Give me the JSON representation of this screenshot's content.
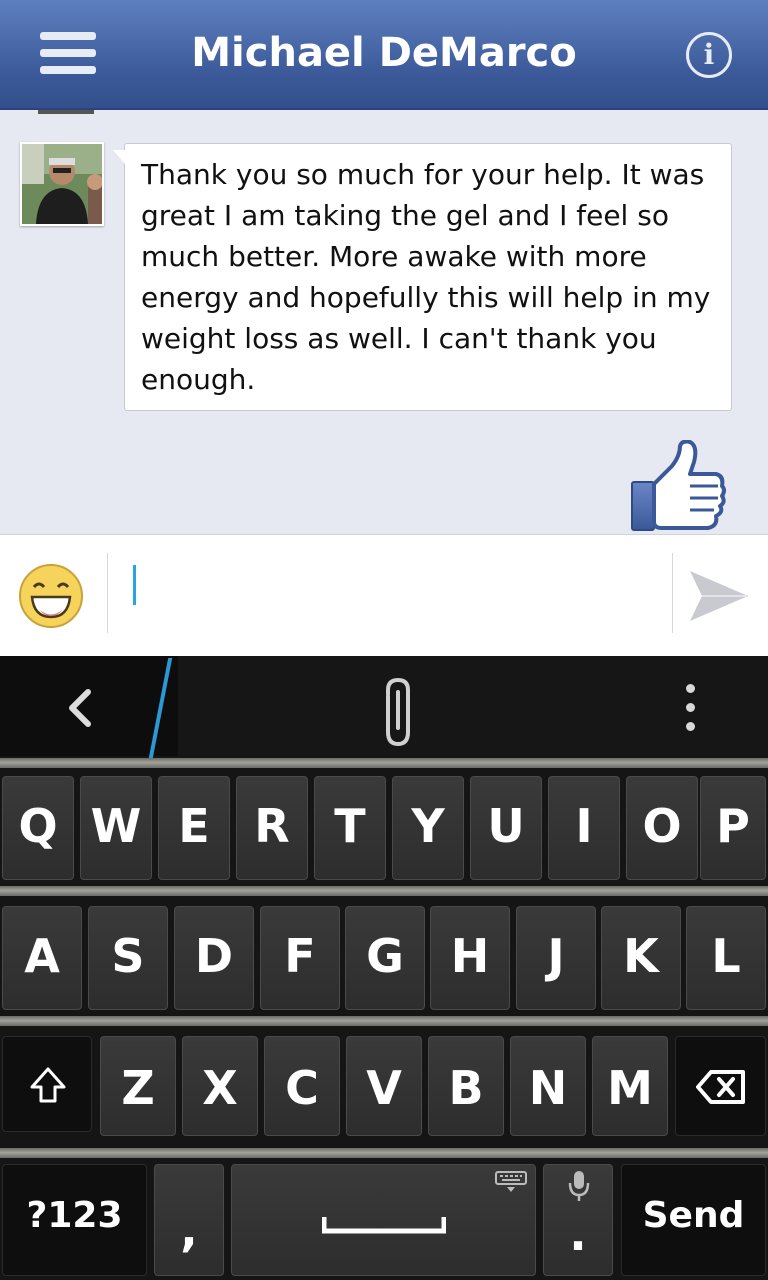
{
  "header": {
    "title": "Michael DeMarco",
    "menu_icon": "hamburger-menu-icon",
    "info_icon": "info-icon"
  },
  "conversation": {
    "message": {
      "sender_avatar": "avatar-photo",
      "text": "Thank you so much for your help. It was great I am taking the gel and I feel so much better. More awake with more energy and hopefully this will help in my weight loss as well. I can't thank you enough."
    },
    "sticker": "thumbs-up-icon"
  },
  "composer": {
    "value": "",
    "emoji_icon": "grinning-emoji-icon",
    "send_icon": "send-arrow-icon"
  },
  "keyboard": {
    "toolbar": {
      "back_icon": "chevron-left-icon",
      "attach_icon": "paperclip-icon",
      "overflow_icon": "more-vertical-icon"
    },
    "row1": [
      "Q",
      "W",
      "E",
      "R",
      "T",
      "Y",
      "U",
      "I",
      "O",
      "P"
    ],
    "row2": [
      "A",
      "S",
      "D",
      "F",
      "G",
      "H",
      "J",
      "K",
      "L"
    ],
    "row3": [
      "Z",
      "X",
      "C",
      "V",
      "B",
      "N",
      "M"
    ],
    "symbols_key": "?123",
    "comma_key": ",",
    "period_key": ".",
    "send_key": "Send",
    "colors": {
      "accent": "#2a9ad6",
      "brand": "#3b5998"
    }
  }
}
